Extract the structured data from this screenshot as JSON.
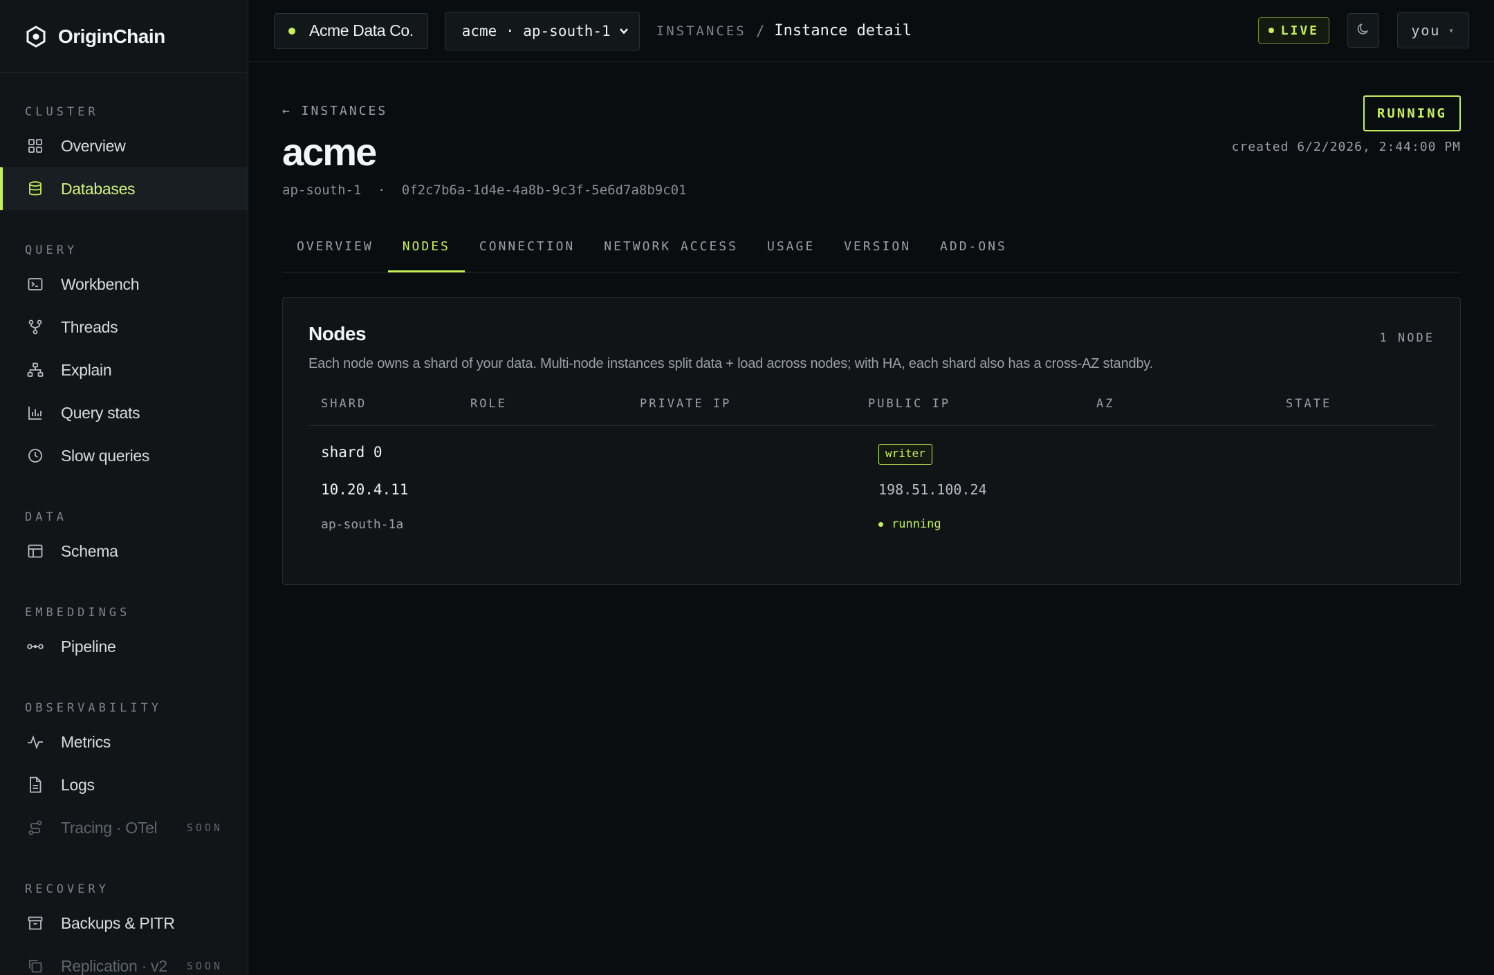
{
  "app": {
    "brand_name": "OriginChain",
    "accent_color": "#c6f05a"
  },
  "sidebar": {
    "sections": [
      {
        "title": "CLUSTER",
        "items": [
          {
            "label": "Overview",
            "icon": "grid-icon"
          },
          {
            "label": "Databases",
            "icon": "database-icon",
            "active": true
          }
        ]
      },
      {
        "title": "QUERY",
        "items": [
          {
            "label": "Workbench",
            "icon": "terminal-icon"
          },
          {
            "label": "Threads",
            "icon": "branch-icon"
          },
          {
            "label": "Explain",
            "icon": "tree-icon"
          },
          {
            "label": "Query stats",
            "icon": "bar-chart-icon"
          },
          {
            "label": "Slow queries",
            "icon": "clock-icon"
          }
        ]
      },
      {
        "title": "DATA",
        "items": [
          {
            "label": "Schema",
            "icon": "table-icon"
          }
        ]
      },
      {
        "title": "EMBEDDINGS",
        "items": [
          {
            "label": "Pipeline",
            "icon": "pipeline-icon"
          }
        ]
      },
      {
        "title": "OBSERVABILITY",
        "items": [
          {
            "label": "Metrics",
            "icon": "pulse-icon"
          },
          {
            "label": "Logs",
            "icon": "file-icon"
          },
          {
            "label": "Tracing · OTel",
            "icon": "route-icon",
            "soon": "SOON"
          }
        ]
      },
      {
        "title": "RECOVERY",
        "items": [
          {
            "label": "Backups & PITR",
            "icon": "archive-icon"
          },
          {
            "label": "Replication · v2",
            "icon": "copy-icon",
            "soon": "SOON"
          }
        ]
      }
    ]
  },
  "topbar": {
    "org_name": "Acme Data Co.",
    "instance_select": "acme · ap-south-1",
    "breadcrumb_root": "INSTANCES",
    "breadcrumb_sep": "/",
    "breadcrumb_current": "Instance detail",
    "live_label": "LIVE",
    "user_label": "you",
    "user_caret": "▾"
  },
  "page": {
    "back_label": "← INSTANCES",
    "title": "acme",
    "region": "ap-south-1",
    "separator": "·",
    "instance_id": "0f2c7b6a-1d4e-4a8b-9c3f-5e6d7a8b9c01",
    "status": "RUNNING",
    "created": "created 6/2/2026, 2:44:00 PM"
  },
  "tabs": [
    {
      "label": "OVERVIEW"
    },
    {
      "label": "NODES",
      "active": true
    },
    {
      "label": "CONNECTION"
    },
    {
      "label": "NETWORK ACCESS"
    },
    {
      "label": "USAGE"
    },
    {
      "label": "VERSION"
    },
    {
      "label": "ADD-ONS"
    }
  ],
  "nodes": {
    "title": "Nodes",
    "count_label": "1 NODE",
    "description": "Each node owns a shard of your data. Multi-node instances split data + load across nodes; with HA, each shard also has a cross-AZ standby.",
    "columns": [
      "SHARD",
      "ROLE",
      "PRIVATE IP",
      "PUBLIC IP",
      "AZ",
      "STATE"
    ],
    "rows": [
      {
        "shard": "shard 0",
        "role": "writer",
        "private_ip": "10.20.4.11",
        "public_ip": "198.51.100.24",
        "az": "ap-south-1a",
        "state": "running"
      }
    ]
  }
}
